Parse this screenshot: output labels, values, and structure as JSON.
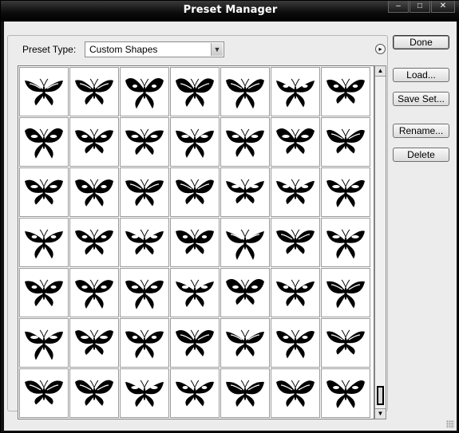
{
  "window": {
    "title": "Preset Manager",
    "controls": {
      "minimize": "‒",
      "maximize": "□",
      "close": "✕"
    }
  },
  "preset_type": {
    "label": "Preset Type:",
    "value": "Custom Shapes",
    "arrow": "▼"
  },
  "flyout": {
    "glyph": "▸",
    "icon": "flyout-menu-icon"
  },
  "buttons": {
    "done": "Done",
    "load": "Load...",
    "save": "Save Set...",
    "rename": "Rename...",
    "delete": "Delete"
  },
  "scroll": {
    "up": "▲",
    "down": "▼"
  },
  "shapes": {
    "rows": 7,
    "columns": 7,
    "count": 49,
    "icon": "butterfly-icon"
  }
}
